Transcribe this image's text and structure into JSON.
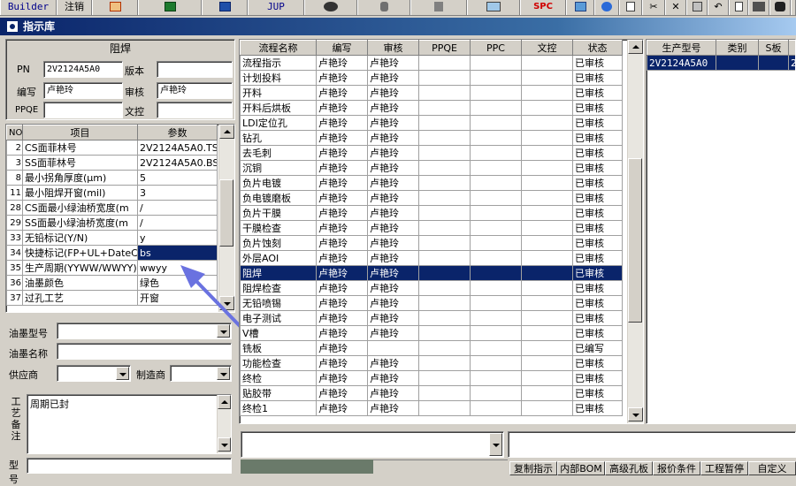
{
  "toolbar": {
    "builder": "Builder",
    "logout": "注销",
    "jup": "JUP",
    "spc": "SPC"
  },
  "window": {
    "title": "指示库"
  },
  "left": {
    "process_title": "阻焊",
    "pn_label": "PN",
    "pn_value": "2V2124A5A0",
    "version_label": "版本",
    "version_value": "",
    "writer_label": "编写",
    "writer_value": "卢艳玲",
    "review_label": "审核",
    "review_value": "卢艳玲",
    "ppqe_label": "PPQE",
    "ppqe_value": "",
    "doc_label": "文控",
    "doc_value": "",
    "param_headers": {
      "no": "NO",
      "item": "项目",
      "param": "参数"
    },
    "params": [
      {
        "no": "2",
        "item": "CS面菲林号",
        "param": "2V2124A5A0.TS"
      },
      {
        "no": "3",
        "item": "SS面菲林号",
        "param": "2V2124A5A0.BS"
      },
      {
        "no": "8",
        "item": "最小拐角厚度(μm)",
        "param": "5"
      },
      {
        "no": "11",
        "item": "最小阻焊开窗(mil)",
        "param": "3"
      },
      {
        "no": "28",
        "item": "CS面最小绿油桥宽度(m",
        "param": "/"
      },
      {
        "no": "29",
        "item": "SS面最小绿油桥宽度(m",
        "param": "/"
      },
      {
        "no": "33",
        "item": "无铅标记(Y/N)",
        "param": "y"
      },
      {
        "no": "34",
        "item": "快捷标记(FP+UL+DateCo",
        "param": "bs"
      },
      {
        "no": "35",
        "item": "生产周期(YYWW/WWYY)",
        "param": "wwyy"
      },
      {
        "no": "36",
        "item": "油墨颜色",
        "param": "绿色"
      },
      {
        "no": "37",
        "item": "过孔工艺",
        "param": "开窗"
      }
    ],
    "ink_type_label": "油墨型号",
    "ink_type_value": "",
    "ink_name_label": "油墨名称",
    "ink_name_value": "",
    "supplier_label": "供应商",
    "supplier_value": "",
    "maker_label": "制造商",
    "maker_value": "",
    "remark_label": "工艺备注",
    "remark_value": "周期已封",
    "model_label": "型号"
  },
  "flow": {
    "headers": [
      "流程名称",
      "编写",
      "审核",
      "PPQE",
      "PPC",
      "文控",
      "状态"
    ],
    "rows": [
      [
        "流程指示",
        "卢艳玲",
        "卢艳玲",
        "",
        "",
        "",
        "已审核"
      ],
      [
        "计划投料",
        "卢艳玲",
        "卢艳玲",
        "",
        "",
        "",
        "已审核"
      ],
      [
        "开料",
        "卢艳玲",
        "卢艳玲",
        "",
        "",
        "",
        "已审核"
      ],
      [
        "开料后烘板",
        "卢艳玲",
        "卢艳玲",
        "",
        "",
        "",
        "已审核"
      ],
      [
        "LDI定位孔",
        "卢艳玲",
        "卢艳玲",
        "",
        "",
        "",
        "已审核"
      ],
      [
        "钻孔",
        "卢艳玲",
        "卢艳玲",
        "",
        "",
        "",
        "已审核"
      ],
      [
        "去毛刺",
        "卢艳玲",
        "卢艳玲",
        "",
        "",
        "",
        "已审核"
      ],
      [
        "沉铜",
        "卢艳玲",
        "卢艳玲",
        "",
        "",
        "",
        "已审核"
      ],
      [
        "负片电镀",
        "卢艳玲",
        "卢艳玲",
        "",
        "",
        "",
        "已审核"
      ],
      [
        "负电镀磨板",
        "卢艳玲",
        "卢艳玲",
        "",
        "",
        "",
        "已审核"
      ],
      [
        "负片干膜",
        "卢艳玲",
        "卢艳玲",
        "",
        "",
        "",
        "已审核"
      ],
      [
        "干膜检查",
        "卢艳玲",
        "卢艳玲",
        "",
        "",
        "",
        "已审核"
      ],
      [
        "负片蚀刻",
        "卢艳玲",
        "卢艳玲",
        "",
        "",
        "",
        "已审核"
      ],
      [
        "外层AOI",
        "卢艳玲",
        "卢艳玲",
        "",
        "",
        "",
        "已审核"
      ],
      [
        "阻焊",
        "卢艳玲",
        "卢艳玲",
        "",
        "",
        "",
        "已审核"
      ],
      [
        "阻焊检查",
        "卢艳玲",
        "卢艳玲",
        "",
        "",
        "",
        "已审核"
      ],
      [
        "无铅喷锡",
        "卢艳玲",
        "卢艳玲",
        "",
        "",
        "",
        "已审核"
      ],
      [
        "电子测试",
        "卢艳玲",
        "卢艳玲",
        "",
        "",
        "",
        "已审核"
      ],
      [
        "V槽",
        "卢艳玲",
        "卢艳玲",
        "",
        "",
        "",
        "已审核"
      ],
      [
        "铣板",
        "卢艳玲",
        "",
        "",
        "",
        "",
        "已编写"
      ],
      [
        "功能检查",
        "卢艳玲",
        "卢艳玲",
        "",
        "",
        "",
        "已审核"
      ],
      [
        "终检",
        "卢艳玲",
        "卢艳玲",
        "",
        "",
        "",
        "已审核"
      ],
      [
        "贴胶带",
        "卢艳玲",
        "卢艳玲",
        "",
        "",
        "",
        "已审核"
      ],
      [
        "终检1",
        "卢艳玲",
        "卢艳玲",
        "",
        "",
        "",
        "已审核"
      ]
    ]
  },
  "right": {
    "headers": [
      "生产型号",
      "类别",
      "S板",
      ""
    ],
    "rows": [
      [
        "2V2124A5A0",
        "",
        "",
        "2"
      ]
    ]
  },
  "bottom_buttons": [
    "复制指示",
    "内部BOM",
    "高级孔板",
    "报价条件",
    "工程暂停",
    "自定义"
  ]
}
